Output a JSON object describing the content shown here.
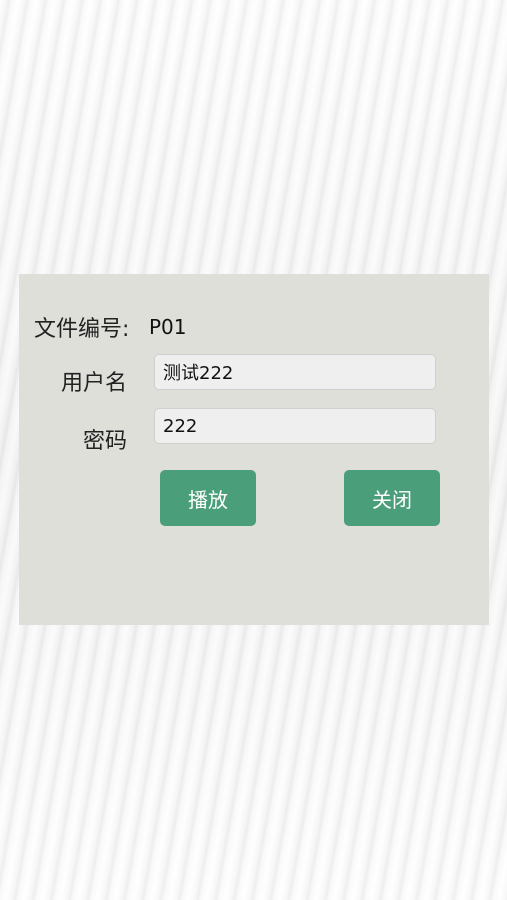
{
  "form": {
    "file_no_label": "文件编号:",
    "file_no_value": "P01",
    "username_label": "用户名",
    "username_value": "测试222",
    "password_label": "密码",
    "password_value": "222",
    "play_button": "播放",
    "close_button": "关闭"
  },
  "colors": {
    "panel_bg": "#dfdfda",
    "button_bg": "#4a9e7a",
    "field_bg": "#efefef"
  }
}
